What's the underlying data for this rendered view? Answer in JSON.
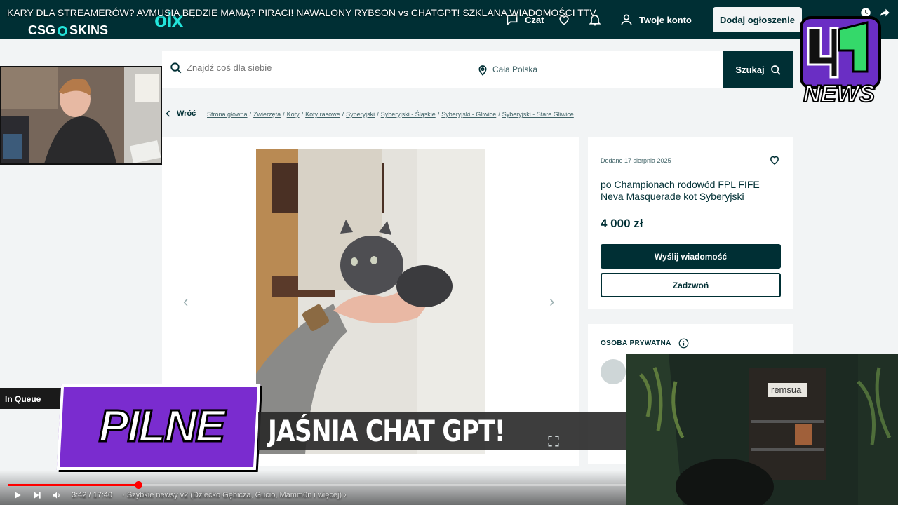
{
  "youtube": {
    "video_title": "KARY DLA STREAMERÓW? AVMUSIA BĘDZIE MAMĄ? PIRACI! NAWALONY RYBSON vs CHATGPT! SZKLANA WIADOMOŚCI TTV",
    "current_time": "3:42",
    "duration": "17:40",
    "time_display": "3:42 / 17:40",
    "chapter": "· Szybkie newsy v2 (Dziecko Gębicza, Gucio, Mamm0n i więcej) ›",
    "progress_fraction": 0.21
  },
  "sponsor": {
    "logo_text_left": "CSG",
    "logo_text_right": "SKINS"
  },
  "olx_header": {
    "logo": "olx",
    "chat_label": "Czat",
    "account_label": "Twoje konto",
    "post_ad_label": "Dodaj ogłoszenie"
  },
  "search": {
    "placeholder": "Znajdź coś dla siebie",
    "location": "Cała Polska",
    "button_label": "Szukaj"
  },
  "breadcrumb": {
    "back_label": "Wróć",
    "items": [
      "Strona główna",
      "Zwierzęta",
      "Koty",
      "Koty rasowe",
      "Syberyjski",
      "Syberyjski - Śląskie",
      "Syberyjski - Gliwice",
      "Syberyjski - Stare Gliwice"
    ]
  },
  "ad": {
    "added_date": "Dodane 17 sierpnia 2025",
    "title": "po Championach rodowód FPL FIFE Neva Masquerade kot Syberyjski",
    "price": "4 000 zł",
    "message_button": "Wyślij wiadomość",
    "call_button": "Zadzwoń"
  },
  "seller": {
    "section_label": "OSOBA PRYWATNA"
  },
  "overlay": {
    "queue_label": "In Queue",
    "pilne_label": "PILNE",
    "headline": "JAŚNIA CHAT GPT!",
    "news_logo": "NEWS",
    "webcam_sign": "remsua"
  },
  "colors": {
    "olx_dark": "#002f34",
    "olx_accent": "#23e5db",
    "pilne_purple": "#7a2ccf",
    "youtube_red": "#ff0000"
  }
}
